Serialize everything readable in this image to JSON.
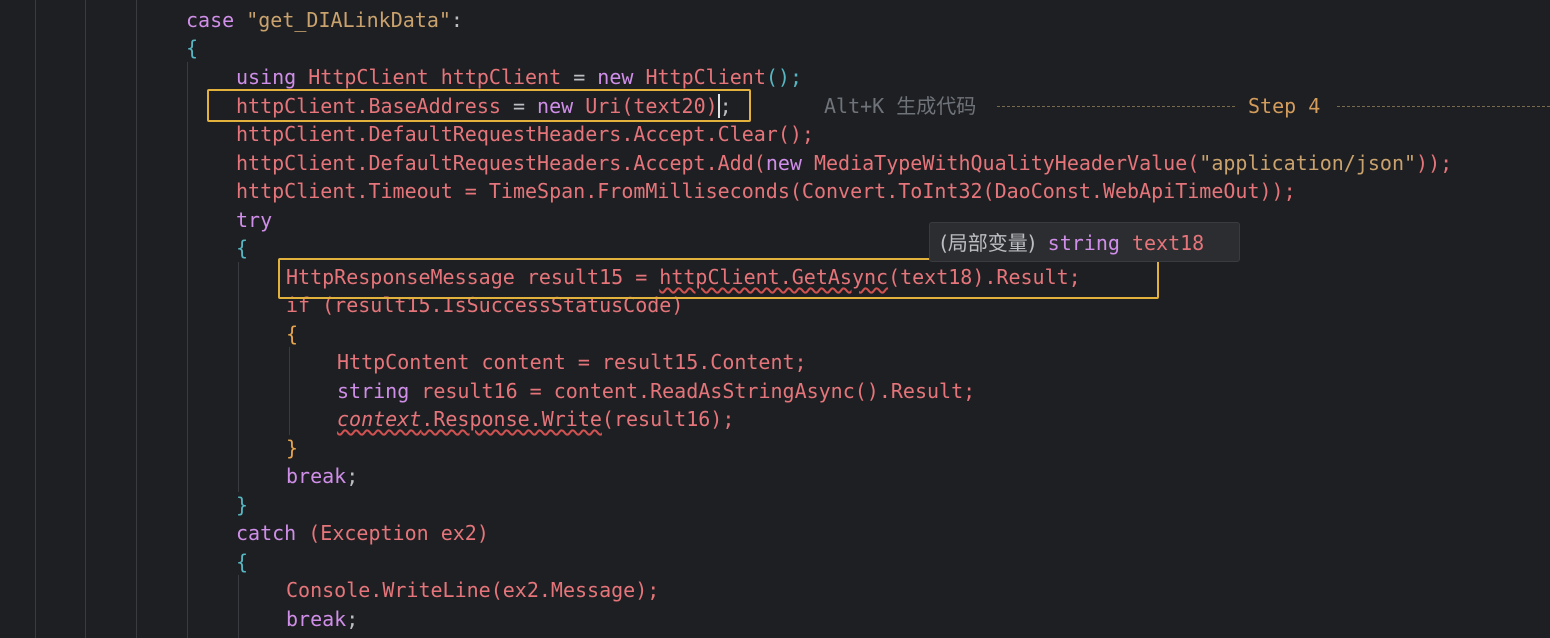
{
  "code": {
    "line1_case": "case",
    "line1_str": "\"get_DIALinkData\"",
    "line1_colon": ":",
    "brace_open": "{",
    "brace_close": "}",
    "l3_using": "using",
    "l3_type": "HttpClient",
    "l3_var": " httpClient ",
    "l3_eq": "= ",
    "l3_new": "new",
    "l3_ctor": " HttpClient",
    "l3_end": "();",
    "l4_obj": "httpClient",
    "l4_prop": ".BaseAddress",
    "l4_eq": " = ",
    "l4_new": "new",
    "l4_uri": " Uri",
    "l4_arg": "(text20)",
    "l4_end": ";",
    "l5": "httpClient.DefaultRequestHeaders.Accept.Clear();",
    "l6_a": "httpClient.DefaultRequestHeaders.Accept.Add(",
    "l6_new": "new",
    "l6_b": " MediaTypeWithQualityHeaderValue(",
    "l6_str": "\"application/json\"",
    "l6_c": "));",
    "l7": "httpClient.Timeout = TimeSpan.FromMilliseconds(Convert.ToInt32(DaoConst.WebApiTimeOut));",
    "l8_try": "try",
    "l10_type": "HttpResponseMessage",
    "l10_var": " result15 = ",
    "l10_call": "httpClient.GetAsync",
    "l10_arg": "(text18)",
    "l10_end": ".Result;",
    "l11": "if (result15.IsSuccessStatusCode)",
    "l13": "HttpContent content = result15.Content;",
    "l14_kw": "string",
    "l14_rest": " result16 = content.ReadAsStringAsync().Result;",
    "l15_ctx": "context",
    "l15_rest": ".Response.Write",
    "l15_arg": "(result16);",
    "l17_break": "break",
    "semicolon": ";",
    "l19_catch": "catch",
    "l19_rest": " (Exception ex2)",
    "l21": "Console.WriteLine(ex2.Message);",
    "l22_break": "break"
  },
  "hint": {
    "shortcut": "Alt+K",
    "label": "生成代码"
  },
  "step": "Step 4",
  "tooltip": {
    "kind": "(局部变量)",
    "type": "string",
    "name": "text18"
  },
  "colors": {
    "background": "#1e1f22",
    "highlight_box": "#e3b23c",
    "keyword": "#cf8ee8",
    "identifier": "#e5757a",
    "string": "#c9a26d"
  }
}
